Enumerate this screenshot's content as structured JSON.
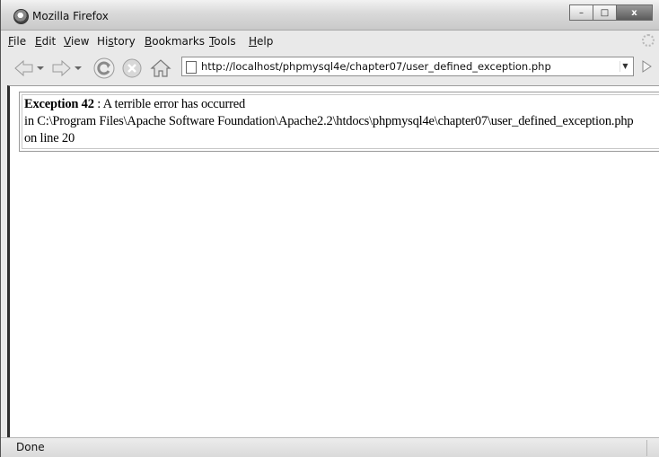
{
  "window": {
    "title": "Mozilla Firefox",
    "controls": {
      "minimize": "–",
      "maximize": "□",
      "close": "x"
    }
  },
  "menubar": {
    "items": [
      {
        "accel": "F",
        "rest": "ile"
      },
      {
        "accel": "E",
        "rest": "dit"
      },
      {
        "accel": "V",
        "rest": "iew"
      },
      {
        "pre": "Hi",
        "accel": "s",
        "rest": "tory"
      },
      {
        "accel": "B",
        "rest": "ookmarks"
      },
      {
        "accel": "T",
        "rest": "ools"
      },
      {
        "accel": "H",
        "rest": "elp"
      }
    ]
  },
  "toolbar": {
    "url": "http://localhost/phpmysql4e/chapter07/user_defined_exception.php",
    "icons": [
      "back-arrow-icon",
      "forward-arrow-icon",
      "reload-icon",
      "stop-icon",
      "home-icon",
      "page-icon",
      "go-icon"
    ]
  },
  "page": {
    "exception_label": "Exception 42",
    "message": " : A terrible error has occurred",
    "path_line": "in C:\\Program Files\\Apache Software Foundation\\Apache2.2\\htdocs\\phpmysql4e\\chapter07\\user_defined_exception.php",
    "line_info": "on line 20"
  },
  "statusbar": {
    "text": "Done"
  }
}
